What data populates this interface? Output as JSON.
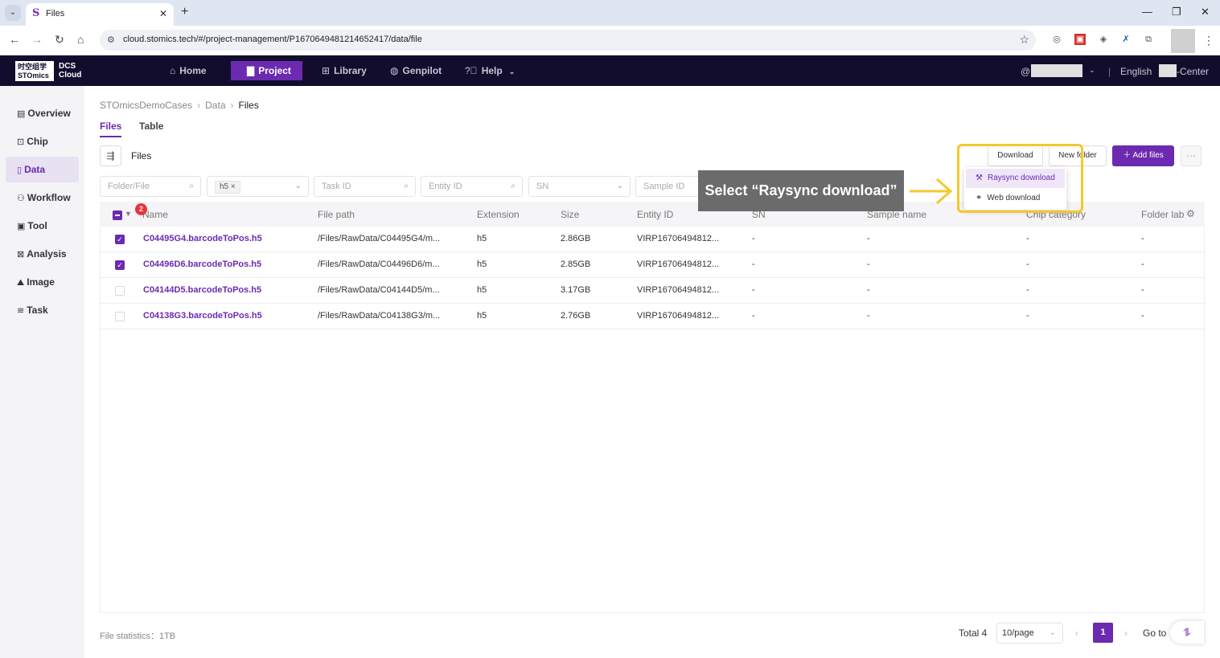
{
  "browser": {
    "tab_title": "Files",
    "tab_favicon": "S",
    "url": "cloud.stomics.tech/#/project-management/P1670649481214652417/data/file",
    "win_minimize": "—",
    "win_restore": "❐",
    "win_close": "✕"
  },
  "header": {
    "logo_cn": "时空组学",
    "logo_en": "STOmics",
    "logo_dcs": "DCS",
    "logo_cloud": "Cloud",
    "nav": [
      {
        "label": "Home",
        "icon": "home-icon"
      },
      {
        "label": "Project",
        "icon": "document-icon"
      },
      {
        "label": "Library",
        "icon": "grid-icon"
      },
      {
        "label": "Genpilot",
        "icon": "globe-icon"
      },
      {
        "label": "Help",
        "icon": "question-icon"
      }
    ],
    "language": "English",
    "center_label": "-Center"
  },
  "sidebar": {
    "items": [
      {
        "label": "Overview"
      },
      {
        "label": "Chip"
      },
      {
        "label": "Data"
      },
      {
        "label": "Workflow"
      },
      {
        "label": "Tool"
      },
      {
        "label": "Analysis"
      },
      {
        "label": "Image"
      },
      {
        "label": "Task"
      }
    ]
  },
  "breadcrumb": [
    "STOmicsDemoCases",
    "Data",
    "Files"
  ],
  "subtabs": [
    "Files",
    "Table"
  ],
  "section_title": "Files",
  "toolbar": {
    "download": "Download",
    "new_folder": "New folder",
    "add_files": "Add files"
  },
  "filters": {
    "folder_file": "Folder/File",
    "extension_tag": "h5",
    "task_id": "Task ID",
    "entity_id": "Entity ID",
    "sn": "SN",
    "sample_id": "Sample ID"
  },
  "table": {
    "selected_count": "2",
    "columns": [
      "Name",
      "File path",
      "Extension",
      "Size",
      "Entity ID",
      "SN",
      "Sample name",
      "Chip category",
      "Folder label"
    ],
    "rows": [
      {
        "checked": true,
        "name": "C04495G4.barcodeToPos.h5",
        "path": "/Files/RawData/C04495G4/m...",
        "ext": "h5",
        "size": "2.86GB",
        "entity": "VIRP16706494812...",
        "sn": "-",
        "sample": "-",
        "chip": "-",
        "folder": "-"
      },
      {
        "checked": true,
        "name": "C04496D6.barcodeToPos.h5",
        "path": "/Files/RawData/C04496D6/m...",
        "ext": "h5",
        "size": "2.85GB",
        "entity": "VIRP16706494812...",
        "sn": "-",
        "sample": "-",
        "chip": "-",
        "folder": "-"
      },
      {
        "checked": false,
        "name": "C04144D5.barcodeToPos.h5",
        "path": "/Files/RawData/C04144D5/m...",
        "ext": "h5",
        "size": "3.17GB",
        "entity": "VIRP16706494812...",
        "sn": "-",
        "sample": "-",
        "chip": "-",
        "folder": "-"
      },
      {
        "checked": false,
        "name": "C04138G3.barcodeToPos.h5",
        "path": "/Files/RawData/C04138G3/m...",
        "ext": "h5",
        "size": "2.76GB",
        "entity": "VIRP16706494812...",
        "sn": "-",
        "sample": "-",
        "chip": "-",
        "folder": "-"
      }
    ]
  },
  "footer": {
    "stats": "File statistics：1TB",
    "total": "Total 4",
    "page_size": "10/page",
    "page": "1",
    "goto": "Go to"
  },
  "dropdown": {
    "items": [
      "Raysync download",
      "Web download"
    ]
  },
  "annotation": {
    "callout": "Select “Raysync download”",
    "highlight_color": "#f5c82b"
  },
  "colors": {
    "brand": "#6b2ab0",
    "header_bg": "#130d2d",
    "badge": "#e8343a"
  }
}
